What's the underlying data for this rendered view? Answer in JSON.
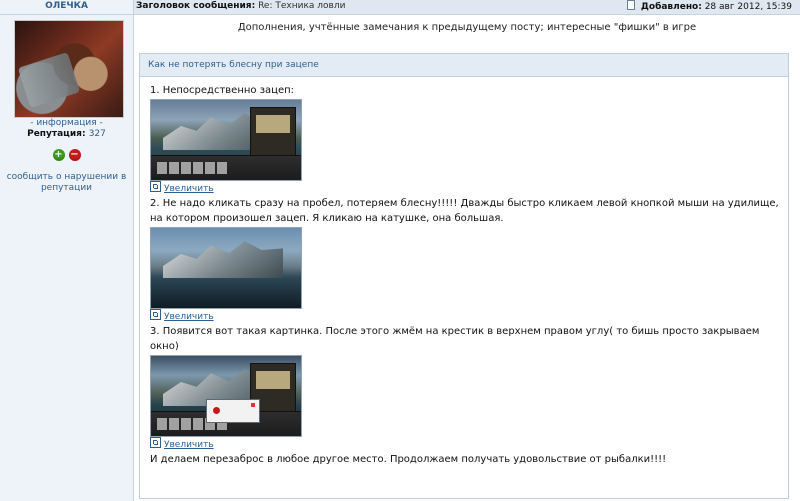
{
  "user": {
    "name": "ОЛЕЧКА",
    "info_link": "- информация -",
    "reputation_label": "Репутация:",
    "reputation_value": "327",
    "report_link": "сообщить о нарушении в репутации"
  },
  "post": {
    "subject_label": "Заголовок сообщения:",
    "subject": "Re: Техника ловли",
    "added_label": "Добавлено:",
    "added_date": "28 авг 2012, 15:39",
    "description": "Дополнения, учтённые замечания к предыдущему посту; интересные \"фишки\" в игре"
  },
  "spoiler": {
    "title": "Как не потерять блесну при зацепе",
    "steps": [
      "1. Непосредственно зацеп:",
      "2. Не надо кликать сразу на пробел, потеряем блесну!!!!! Дважды быстро кликаем левой кнопкой мыши на удилище, на котором произошел зацеп. Я кликаю на катушке, она большая.",
      "3. Появится вот такая картинка. После этого жмём на крестик в верхнем правом углу( то бишь просто закрываем окно)",
      "И делаем перезаброс в любое другое место. Продолжаем получать удовольствие от рыбалки!!!!"
    ],
    "enlarge_label": "Увеличить"
  },
  "colors": {
    "link": "#2f5f8f",
    "panel_bg": "#eef3f9",
    "header_bg": "#dfe8f1"
  }
}
